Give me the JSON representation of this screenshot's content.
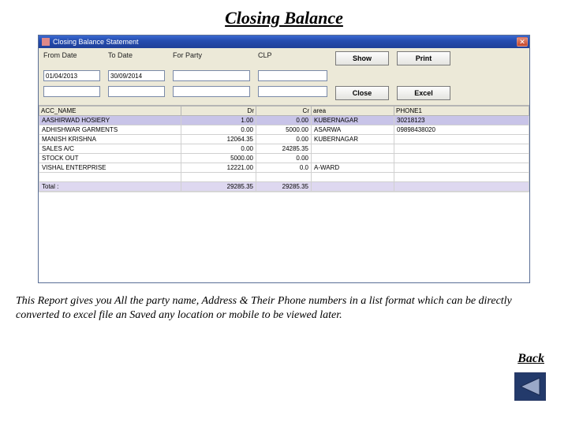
{
  "page": {
    "title": "Closing Balance"
  },
  "window": {
    "title": "Closing Balance Statement"
  },
  "fields": {
    "from_date": {
      "label": "From Date",
      "value": "01/04/2013"
    },
    "to_date": {
      "label": "To Date",
      "value": "30/09/2014"
    },
    "for_party": {
      "label": "For Party",
      "value": ""
    },
    "clp": {
      "label": "CLP",
      "value": ""
    }
  },
  "buttons": {
    "show": "Show",
    "print": "Print",
    "close": "Close",
    "excel": "Excel"
  },
  "grid": {
    "headers": [
      "ACC_NAME",
      "Dr",
      "Cr",
      "area",
      "PHONE1"
    ],
    "rows": [
      {
        "name": "AASHIRWAD HOSIERY",
        "dr": "1.00",
        "cr": "0.00",
        "area": "KUBERNAGAR",
        "phone": "30218123"
      },
      {
        "name": "ADHISHWAR GARMENTS",
        "dr": "0.00",
        "cr": "5000.00",
        "area": "ASARWA",
        "phone": "09898438020"
      },
      {
        "name": "MANISH KRISHNA",
        "dr": "12064.35",
        "cr": "0.00",
        "area": "KUBERNAGAR",
        "phone": ""
      },
      {
        "name": "SALES A/C",
        "dr": "0.00",
        "cr": "24285.35",
        "area": "",
        "phone": ""
      },
      {
        "name": "STOCK OUT",
        "dr": "5000.00",
        "cr": "0.00",
        "area": "",
        "phone": ""
      },
      {
        "name": "VISHAL ENTERPRISE",
        "dr": "12221.00",
        "cr": "0.0",
        "area": "A-WARD",
        "phone": ""
      }
    ],
    "total": {
      "label": "Total :",
      "dr": "29285.35",
      "cr": "29285.35"
    }
  },
  "description": "This Report gives you All the party name, Address & Their Phone numbers in a list format which can be directly converted to excel file an Saved any location or mobile to be viewed later.",
  "back": "Back"
}
